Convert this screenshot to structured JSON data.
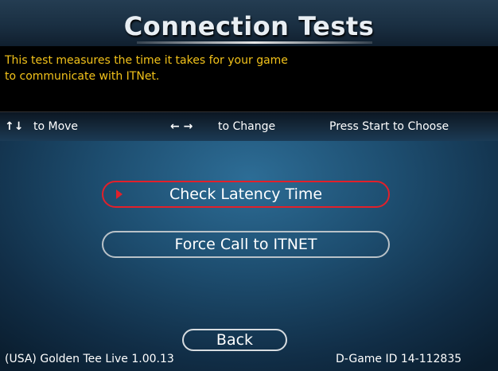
{
  "header": {
    "title": "Connection Tests"
  },
  "description": {
    "line1": "This test measures the time it takes for your game",
    "line2": "to communicate with ITNet."
  },
  "nav_hints": {
    "move_glyph": "↑↓",
    "move_label": "to Move",
    "change_glyph": "← →",
    "change_label": "to Change",
    "choose_label": "Press Start to Choose"
  },
  "menu": {
    "items": [
      {
        "label": "Check Latency Time",
        "selected": true
      },
      {
        "label": "Force Call to ITNET",
        "selected": false
      }
    ],
    "back_label": "Back"
  },
  "footer": {
    "version": "(USA) Golden Tee Live 1.00.13",
    "game_id": "D-Game ID 14-112835"
  },
  "colors": {
    "description_text": "#f2c21a",
    "selected_border": "#e2202a",
    "button_border": "#b9c2c8"
  }
}
